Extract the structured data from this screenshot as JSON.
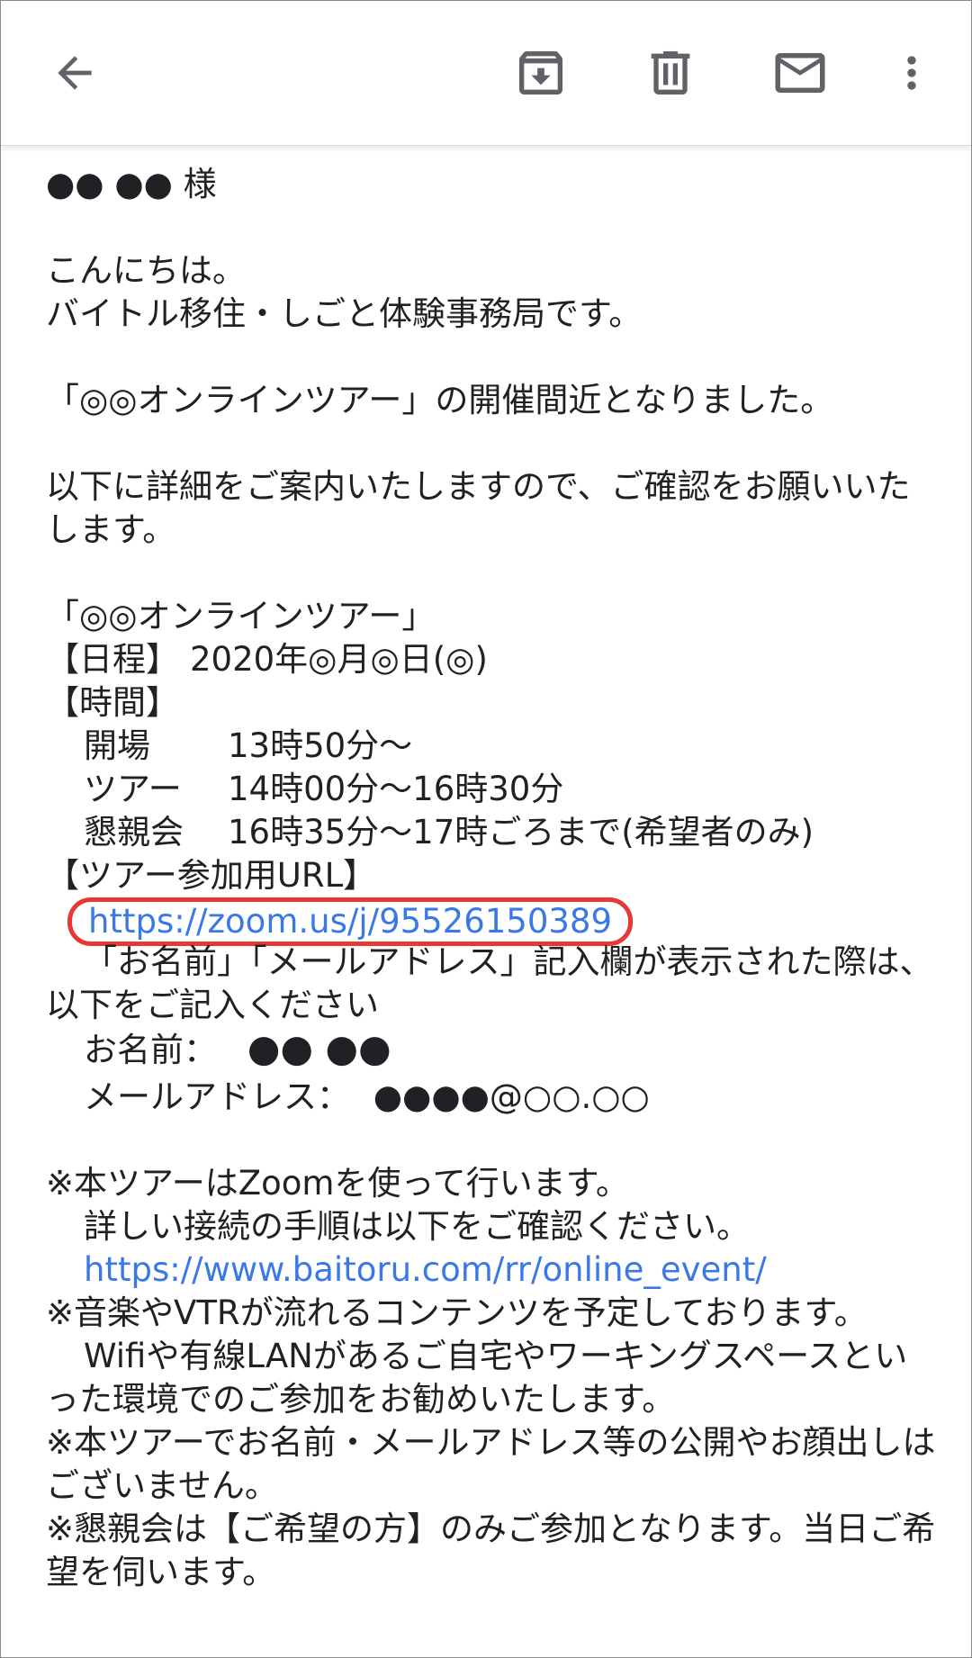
{
  "toolbar": {
    "back_icon": "arrow-left-icon",
    "archive_icon": "archive-icon",
    "delete_icon": "trash-icon",
    "mark_unread_icon": "mail-icon",
    "more_icon": "more-vertical-icon"
  },
  "email": {
    "salutation": "●● ●● 様",
    "greeting": "こんにちは。",
    "office": "バイトル移住・しごと体験事務局です。",
    "announce": "「◎◎オンラインツアー」の開催間近となりました。",
    "intro": "以下に詳細をご案内いたしますので、ご確認をお願いいたします。",
    "tour_name": "「◎◎オンラインツアー」",
    "schedule_label": "【日程】",
    "schedule_value": "2020年◎月◎日(◎)",
    "time_label": "【時間】",
    "times": [
      {
        "label": "開場",
        "value": "13時50分～"
      },
      {
        "label": "ツアー",
        "value": "14時00分～16時30分"
      },
      {
        "label": "懇親会",
        "value": "16時35分～17時ごろまで(希望者のみ)"
      }
    ],
    "url_label": "【ツアー参加用URL】",
    "zoom_url": "https://zoom.us/j/95526150389",
    "form_note": "「お名前」「メールアドレス」記入欄が表示された際は、以下をご記入ください",
    "name_label": "お名前：",
    "name_value": "●● ●●",
    "mail_label": "メールアドレス：",
    "mail_value": "●●●●@○○.○○",
    "note1": "※本ツアーはZoomを使って行います。",
    "note1_sub": "詳しい接続の手順は以下をご確認ください。",
    "guide_url": "https://www.baitoru.com/rr/online_event/",
    "note2": "※音楽やVTRが流れるコンテンツを予定しております。",
    "note2_sub": "Wifiや有線LANがあるご自宅やワーキングスペースといった環境でのご参加をお勧めいたします。",
    "note3": "※本ツアーでお名前・メールアドレス等の公開やお顔出しはございません。",
    "note4": "※懇親会は【ご希望の方】のみご参加となります。当日ご希望を伺います。"
  },
  "colors": {
    "link": "#3b78e7",
    "highlight": "#e53935",
    "icon": "#5f6368"
  }
}
